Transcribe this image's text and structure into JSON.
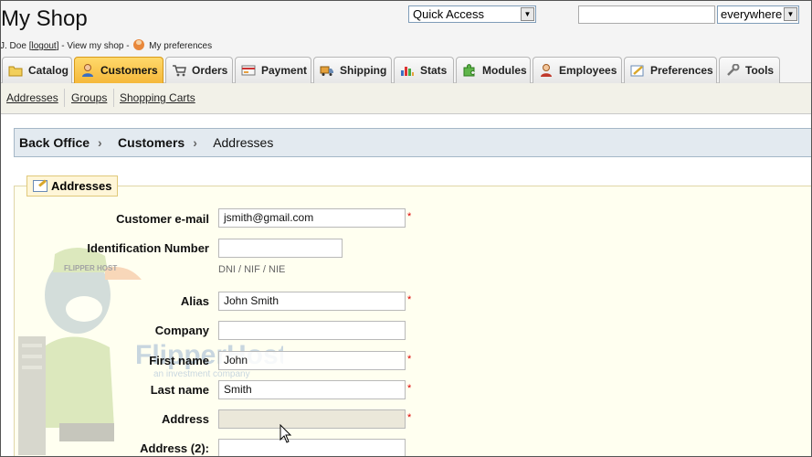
{
  "header": {
    "shop_title": "My Shop",
    "user_name": "J. Doe",
    "logout_label": "logout",
    "view_shop_label": "View my shop",
    "preferences_label": "My preferences"
  },
  "quick_access": {
    "selected": "Quick Access"
  },
  "search": {
    "value": "",
    "scope_selected": "everywhere"
  },
  "tabs": [
    {
      "label": "Catalog",
      "icon": "folder-icon",
      "active": false
    },
    {
      "label": "Customers",
      "icon": "customer-icon",
      "active": true
    },
    {
      "label": "Orders",
      "icon": "cart-icon",
      "active": false
    },
    {
      "label": "Payment",
      "icon": "payment-icon",
      "active": false
    },
    {
      "label": "Shipping",
      "icon": "truck-icon",
      "active": false
    },
    {
      "label": "Stats",
      "icon": "bar-chart-icon",
      "active": false
    },
    {
      "label": "Modules",
      "icon": "puzzle-icon",
      "active": false
    },
    {
      "label": "Employees",
      "icon": "employee-icon",
      "active": false
    },
    {
      "label": "Preferences",
      "icon": "preferences-icon",
      "active": false
    },
    {
      "label": "Tools",
      "icon": "wrench-icon",
      "active": false
    }
  ],
  "subnav": [
    {
      "label": "Addresses"
    },
    {
      "label": "Groups"
    },
    {
      "label": "Shopping Carts"
    }
  ],
  "breadcrumb": [
    "Back Office",
    "Customers",
    "Addresses"
  ],
  "section_title": "Addresses",
  "form": {
    "customer_email": {
      "label": "Customer e-mail",
      "value": "jsmith@gmail.com",
      "required": true
    },
    "identification_number": {
      "label": "Identification Number",
      "value": "",
      "hint": "DNI / NIF / NIE"
    },
    "alias": {
      "label": "Alias",
      "value": "John Smith",
      "required": true
    },
    "company": {
      "label": "Company",
      "value": ""
    },
    "first_name": {
      "label": "First name",
      "value": "John",
      "required": true
    },
    "last_name": {
      "label": "Last name",
      "value": "Smith",
      "required": true
    },
    "address": {
      "label": "Address",
      "value": "",
      "required": true
    },
    "address2": {
      "label": "Address (2):",
      "value": ""
    }
  },
  "required_marker": "*",
  "watermark": {
    "brand": "FlipperHost",
    "tagline": "an investment company",
    "cap_text": "FLIPPER HOST"
  },
  "colors": {
    "active_tab": "#f5b83a",
    "breadcrumb_bg": "#e3eaf0",
    "form_bg": "#fffff0",
    "required": "#dd0000"
  }
}
